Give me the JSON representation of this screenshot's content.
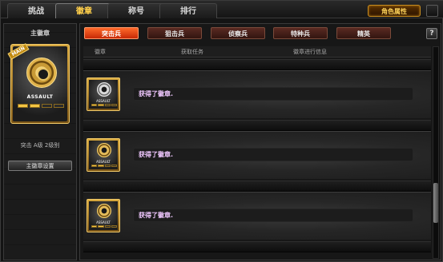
{
  "top_tabs": [
    {
      "label": "挑战",
      "active": false
    },
    {
      "label": "徽章",
      "active": true
    },
    {
      "label": "称号",
      "active": false
    },
    {
      "label": "排行",
      "active": false
    }
  ],
  "role_attr_label": "角色属性",
  "left": {
    "title": "主徽章",
    "badge": {
      "tag": "MAIN",
      "text": "ASSAULT",
      "level_filled": 2,
      "level_total": 4
    },
    "caption": "突击 A级 2级别",
    "main_badge_button": "主徽章设置"
  },
  "subtabs": [
    {
      "label": "突击兵",
      "active": true
    },
    {
      "label": "狙击兵",
      "active": false
    },
    {
      "label": "侦察兵",
      "active": false
    },
    {
      "label": "特种兵",
      "active": false
    },
    {
      "label": "精英",
      "active": false
    }
  ],
  "help_label": "?",
  "columns": [
    "徽章",
    "获取任务",
    "徽章进行信息"
  ],
  "rows": [
    {
      "badge_text": "ASSAULT",
      "message": "获得了徽章.",
      "medal": "silver",
      "filled": 2
    },
    {
      "badge_text": "ASSAULT",
      "message": "获得了徽章.",
      "medal": "gold",
      "filled": 2
    },
    {
      "badge_text": "ASSAULT",
      "message": "获得了徽章.",
      "medal": "gold",
      "filled": 2
    }
  ]
}
